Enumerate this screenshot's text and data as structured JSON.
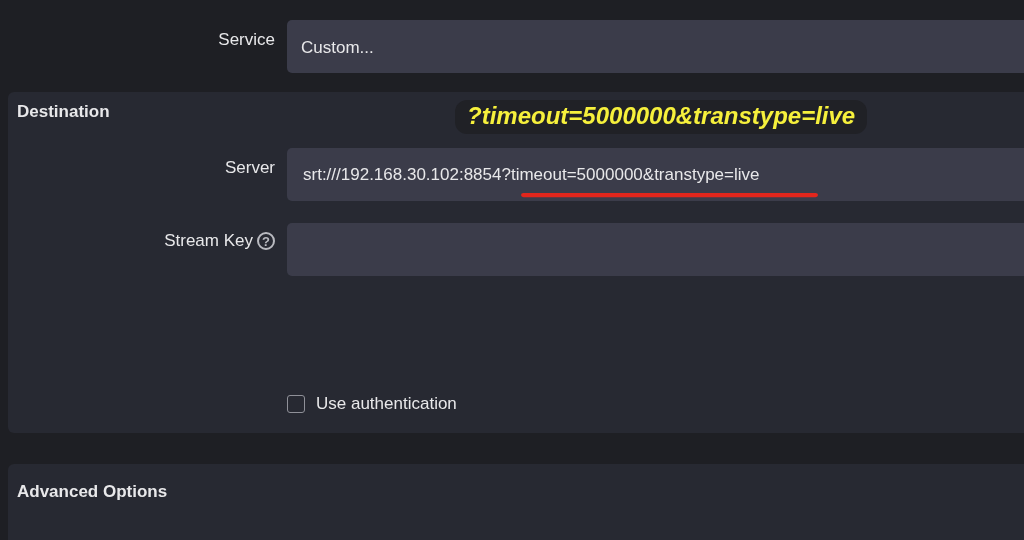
{
  "service": {
    "label": "Service",
    "value": "Custom..."
  },
  "destination": {
    "title": "Destination",
    "annotation": "?timeout=5000000&transtype=live",
    "server": {
      "label": "Server",
      "value": "srt:///192.168.30.102:8854?timeout=5000000&transtype=live"
    },
    "stream_key": {
      "label": "Stream Key",
      "help_icon": "?"
    },
    "use_authentication": {
      "label": "Use authentication",
      "checked": false
    }
  },
  "advanced_options": {
    "title": "Advanced Options"
  }
}
